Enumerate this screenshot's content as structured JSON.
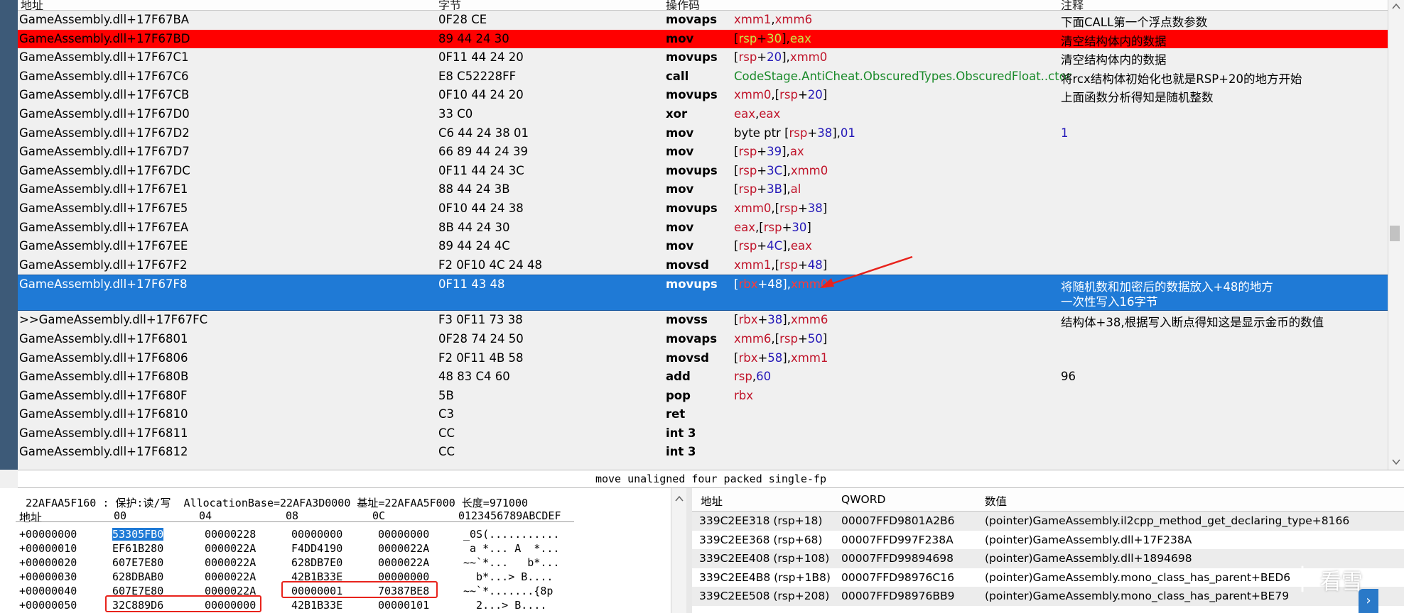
{
  "disasm": {
    "headers": {
      "address": "地址",
      "bytes": "字节",
      "opcode": "操作码",
      "comment": "注释"
    },
    "rows": [
      {
        "addr": "GameAssembly.dll+17F67BA",
        "bytes": "0F28 CE",
        "op": "movaps",
        "args": [
          [
            "reg",
            "xmm1"
          ],
          [
            "txt",
            ","
          ],
          [
            "reg",
            "xmm6"
          ]
        ],
        "cmt": "下面CALL第一个浮点数参数"
      },
      {
        "addr": "GameAssembly.dll+17F67BD",
        "bytes": "89 44 24 30",
        "op": "mov",
        "args": [
          [
            "txt",
            "["
          ],
          [
            "reg",
            "rsp"
          ],
          [
            "txt",
            "+"
          ],
          [
            "num",
            "30"
          ],
          [
            "txt",
            "],"
          ],
          [
            "reg",
            "eax"
          ]
        ],
        "cmt": "清空结构体内的数据",
        "style": "red"
      },
      {
        "addr": "GameAssembly.dll+17F67C1",
        "bytes": "0F11 44 24 20",
        "op": "movups",
        "args": [
          [
            "txt",
            "["
          ],
          [
            "reg",
            "rsp"
          ],
          [
            "txt",
            "+"
          ],
          [
            "num",
            "20"
          ],
          [
            "txt",
            "],"
          ],
          [
            "reg",
            "xmm0"
          ]
        ],
        "cmt": "清空结构体内的数据"
      },
      {
        "addr": "GameAssembly.dll+17F67C6",
        "bytes": "E8 C52228FF",
        "op": "call",
        "args": [
          [
            "sym",
            "CodeStage.AntiCheat.ObscuredTypes.ObscuredFloat..ctor"
          ]
        ],
        "cmt": "将rcx结构体初始化也就是RSP+20的地方开始"
      },
      {
        "addr": "GameAssembly.dll+17F67CB",
        "bytes": "0F10 44 24 20",
        "op": "movups",
        "args": [
          [
            "reg",
            "xmm0"
          ],
          [
            "txt",
            ",["
          ],
          [
            "reg",
            "rsp"
          ],
          [
            "txt",
            "+"
          ],
          [
            "num",
            "20"
          ],
          [
            "txt",
            "]"
          ]
        ],
        "cmt": "上面函数分析得知是随机整数"
      },
      {
        "addr": "GameAssembly.dll+17F67D0",
        "bytes": "33 C0",
        "op": "xor",
        "args": [
          [
            "reg",
            "eax"
          ],
          [
            "txt",
            ","
          ],
          [
            "reg",
            "eax"
          ]
        ],
        "cmt": ""
      },
      {
        "addr": "GameAssembly.dll+17F67D2",
        "bytes": "C6 44 24 38 01",
        "op": "mov",
        "args": [
          [
            "txt",
            "byte ptr ["
          ],
          [
            "reg",
            "rsp"
          ],
          [
            "txt",
            "+"
          ],
          [
            "num",
            "38"
          ],
          [
            "txt",
            "],"
          ],
          [
            "num",
            "01"
          ]
        ],
        "cmt": "1",
        "cmtnum": true
      },
      {
        "addr": "GameAssembly.dll+17F67D7",
        "bytes": "66 89 44 24 39",
        "op": "mov",
        "args": [
          [
            "txt",
            "["
          ],
          [
            "reg",
            "rsp"
          ],
          [
            "txt",
            "+"
          ],
          [
            "num",
            "39"
          ],
          [
            "txt",
            "],"
          ],
          [
            "reg",
            "ax"
          ]
        ],
        "cmt": ""
      },
      {
        "addr": "GameAssembly.dll+17F67DC",
        "bytes": "0F11 44 24 3C",
        "op": "movups",
        "args": [
          [
            "txt",
            "["
          ],
          [
            "reg",
            "rsp"
          ],
          [
            "txt",
            "+"
          ],
          [
            "num",
            "3C"
          ],
          [
            "txt",
            "],"
          ],
          [
            "reg",
            "xmm0"
          ]
        ],
        "cmt": ""
      },
      {
        "addr": "GameAssembly.dll+17F67E1",
        "bytes": "88 44 24 3B",
        "op": "mov",
        "args": [
          [
            "txt",
            "["
          ],
          [
            "reg",
            "rsp"
          ],
          [
            "txt",
            "+"
          ],
          [
            "num",
            "3B"
          ],
          [
            "txt",
            "],"
          ],
          [
            "reg",
            "al"
          ]
        ],
        "cmt": ""
      },
      {
        "addr": "GameAssembly.dll+17F67E5",
        "bytes": "0F10 44 24 38",
        "op": "movups",
        "args": [
          [
            "reg",
            "xmm0"
          ],
          [
            "txt",
            ",["
          ],
          [
            "reg",
            "rsp"
          ],
          [
            "txt",
            "+"
          ],
          [
            "num",
            "38"
          ],
          [
            "txt",
            "]"
          ]
        ],
        "cmt": ""
      },
      {
        "addr": "GameAssembly.dll+17F67EA",
        "bytes": "8B 44 24 30",
        "op": "mov",
        "args": [
          [
            "reg",
            "eax"
          ],
          [
            "txt",
            ",["
          ],
          [
            "reg",
            "rsp"
          ],
          [
            "txt",
            "+"
          ],
          [
            "num",
            "30"
          ],
          [
            "txt",
            "]"
          ]
        ],
        "cmt": ""
      },
      {
        "addr": "GameAssembly.dll+17F67EE",
        "bytes": "89 44 24 4C",
        "op": "mov",
        "args": [
          [
            "txt",
            "["
          ],
          [
            "reg",
            "rsp"
          ],
          [
            "txt",
            "+"
          ],
          [
            "num",
            "4C"
          ],
          [
            "txt",
            "],"
          ],
          [
            "reg",
            "eax"
          ]
        ],
        "cmt": ""
      },
      {
        "addr": "GameAssembly.dll+17F67F2",
        "bytes": "F2 0F10 4C 24 48",
        "op": "movsd",
        "args": [
          [
            "reg",
            "xmm1"
          ],
          [
            "txt",
            ",["
          ],
          [
            "reg",
            "rsp"
          ],
          [
            "txt",
            "+"
          ],
          [
            "num",
            "48"
          ],
          [
            "txt",
            "]"
          ]
        ],
        "cmt": ""
      },
      {
        "addr": "GameAssembly.dll+17F67F8",
        "bytes": "0F11 43 48",
        "op": "movups",
        "args": [
          [
            "brk",
            "["
          ],
          [
            "reg",
            "rbx"
          ],
          [
            "brk",
            "+"
          ],
          [
            "num",
            "48"
          ],
          [
            "brk",
            "],"
          ],
          [
            "reg",
            "xmm0"
          ]
        ],
        "cmt": "将随机数和加密后的数据放入+48的地方",
        "cmt2": "一次性写入16字节",
        "style": "blue"
      },
      {
        "addr": ">>GameAssembly.dll+17F67FC",
        "bytes": "F3 0F11 73 38",
        "op": "movss",
        "args": [
          [
            "txt",
            "["
          ],
          [
            "reg",
            "rbx"
          ],
          [
            "txt",
            "+"
          ],
          [
            "num",
            "38"
          ],
          [
            "txt",
            "],"
          ],
          [
            "reg",
            "xmm6"
          ]
        ],
        "cmt": "结构体+38,根据写入断点得知这是显示金币的数值"
      },
      {
        "addr": "GameAssembly.dll+17F6801",
        "bytes": "0F28 74 24 50",
        "op": "movaps",
        "args": [
          [
            "reg",
            "xmm6"
          ],
          [
            "txt",
            ",["
          ],
          [
            "reg",
            "rsp"
          ],
          [
            "txt",
            "+"
          ],
          [
            "num",
            "50"
          ],
          [
            "txt",
            "]"
          ]
        ],
        "cmt": ""
      },
      {
        "addr": "GameAssembly.dll+17F6806",
        "bytes": "F2 0F11 4B 58",
        "op": "movsd",
        "args": [
          [
            "txt",
            "["
          ],
          [
            "reg",
            "rbx"
          ],
          [
            "txt",
            "+"
          ],
          [
            "num",
            "58"
          ],
          [
            "txt",
            "],"
          ],
          [
            "reg",
            "xmm1"
          ]
        ],
        "cmt": ""
      },
      {
        "addr": "GameAssembly.dll+17F680B",
        "bytes": "48 83 C4 60",
        "op": "add",
        "args": [
          [
            "reg",
            "rsp"
          ],
          [
            "txt",
            ","
          ],
          [
            "num",
            "60"
          ]
        ],
        "cmt": "96"
      },
      {
        "addr": "GameAssembly.dll+17F680F",
        "bytes": "5B",
        "op": "pop",
        "args": [
          [
            "reg",
            "rbx"
          ]
        ],
        "cmt": ""
      },
      {
        "addr": "GameAssembly.dll+17F6810",
        "bytes": "C3",
        "op": "ret",
        "args": [],
        "cmt": ""
      },
      {
        "addr": "GameAssembly.dll+17F6811",
        "bytes": "CC",
        "op": "int 3",
        "args": [],
        "cmt": ""
      },
      {
        "addr": "GameAssembly.dll+17F6812",
        "bytes": "CC",
        "op": "int 3",
        "args": [],
        "cmt": ""
      }
    ],
    "hint": "move unaligned four packed single-fp"
  },
  "hex": {
    "info": "22AFAA5F160 : 保护:读/写  AllocationBase=22AFA3D0000 基址=22AFAA5F000 长度=971000",
    "header": {
      "addr": "地址",
      "c00": "00",
      "c04": "04",
      "c08": "08",
      "c0c": "0C",
      "ascii": "0123456789ABCDEF"
    },
    "rows": [
      {
        "off": "+00000000",
        "d": [
          "53305FB0",
          "00000228",
          "00000000",
          "00000000"
        ],
        "ascii": "_0S(..........."
      },
      {
        "off": "+00000010",
        "d": [
          "EF61B280",
          "0000022A",
          "F4DD4190",
          "0000022A"
        ],
        "ascii": " a *... A  *..."
      },
      {
        "off": "+00000020",
        "d": [
          "607E7E80",
          "0000022A",
          "628DB7E0",
          "0000022A"
        ],
        "ascii": "~~`*...   b*..."
      },
      {
        "off": "+00000030",
        "d": [
          "628DBAB0",
          "0000022A",
          "42B1B33E",
          "00000000"
        ],
        "ascii": "  b*...> B...."
      },
      {
        "off": "+00000040",
        "d": [
          "607E7E80",
          "0000022A",
          "00000001",
          "70387BE8"
        ],
        "ascii": "~~`*.......{8p"
      },
      {
        "off": "+00000050",
        "d": [
          "32C889D6",
          "00000000",
          "42B1B33E",
          "00000101"
        ],
        "ascii": "  2...> B...."
      }
    ]
  },
  "stack": {
    "headers": {
      "addr": "地址",
      "qword": "QWORD",
      "value": "数值"
    },
    "rows": [
      {
        "addr": "339C2EE318 (rsp+18)",
        "qword": "00007FFD9801A2B6",
        "value": "(pointer)GameAssembly.il2cpp_method_get_declaring_type+8166"
      },
      {
        "addr": "339C2EE368 (rsp+68)",
        "qword": "00007FFD997F238A",
        "value": "(pointer)GameAssembly.dll+17F238A"
      },
      {
        "addr": "339C2EE408 (rsp+108)",
        "qword": "00007FFD99894698",
        "value": "(pointer)GameAssembly.dll+1894698"
      },
      {
        "addr": "339C2EE4B8 (rsp+1B8)",
        "qword": "00007FFD98976C16",
        "value": "(pointer)GameAssembly.mono_class_has_parent+BED6"
      },
      {
        "addr": "339C2EE508 (rsp+208)",
        "qword": "00007FFD98976BB9",
        "value": "(pointer)GameAssembly.mono_class_has_parent+BE79"
      }
    ]
  },
  "watermark": "看雪",
  "icons": {
    "annotation_arrow": "arrow-icon",
    "watermark": "snowflake-icon"
  },
  "colors": {
    "highlight_red": "#ff0000",
    "selection_blue": "#1f7ad6",
    "register": "#c0142a",
    "number": "#2418b8",
    "symbol": "#1a8a2a"
  }
}
